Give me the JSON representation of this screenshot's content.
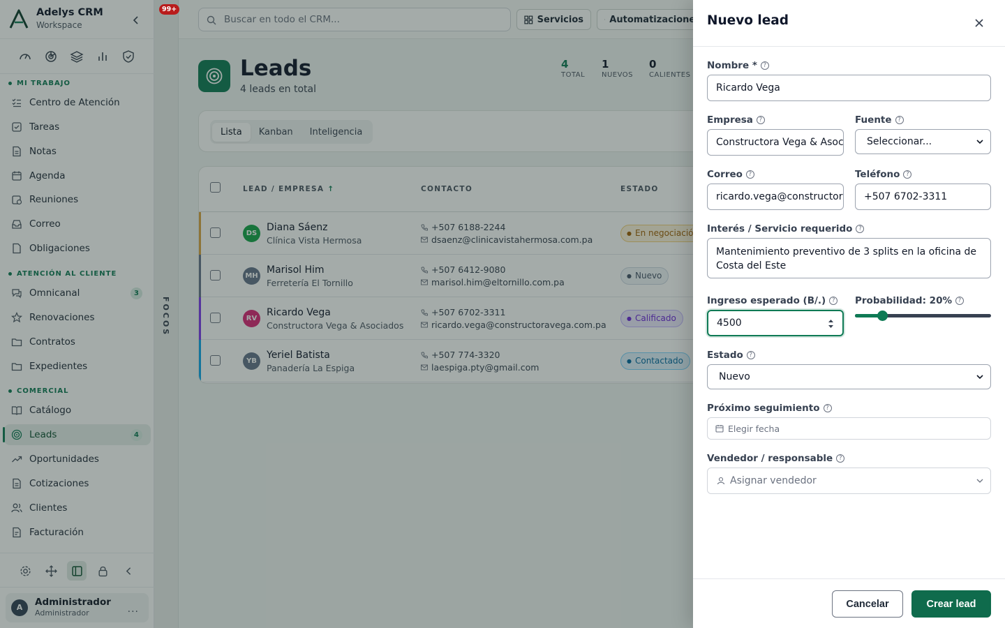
{
  "brand": {
    "title": "Adelys CRM",
    "subtitle": "Workspace"
  },
  "notification_badge": "99+",
  "sidebar": {
    "sections": {
      "mi_trabajo": "MI TRABAJO",
      "atencion": "ATENCIÓN AL CLIENTE",
      "comercial": "COMERCIAL"
    },
    "items": [
      {
        "label": "Centro de Atención"
      },
      {
        "label": "Tareas"
      },
      {
        "label": "Notas"
      },
      {
        "label": "Agenda"
      },
      {
        "label": "Reuniones"
      },
      {
        "label": "Correo"
      },
      {
        "label": "Obligaciones"
      },
      {
        "label": "Omnicanal",
        "badge": "3"
      },
      {
        "label": "Renovaciones"
      },
      {
        "label": "Contratos"
      },
      {
        "label": "Expedientes"
      },
      {
        "label": "Catálogo"
      },
      {
        "label": "Leads",
        "badge": "4"
      },
      {
        "label": "Oportunidades"
      },
      {
        "label": "Cotizaciones"
      },
      {
        "label": "Clientes"
      },
      {
        "label": "Facturación"
      }
    ]
  },
  "user": {
    "name": "Administrador",
    "role": "Administrador",
    "initial": "A",
    "more": "···"
  },
  "focus_label": "FOCOS",
  "topbar": {
    "search_placeholder": "Buscar en todo el CRM...",
    "btn_servicios": "Servicios",
    "btn_automatizaciones": "Automatizaciones"
  },
  "page": {
    "title": "Leads",
    "subtitle": "4 leads en total",
    "stats": [
      {
        "value": "4",
        "label": "TOTAL"
      },
      {
        "value": "1",
        "label": "NUEVOS"
      },
      {
        "value": "0",
        "label": "CALIENTES"
      }
    ]
  },
  "view_tabs": [
    "Lista",
    "Kanban",
    "Inteligencia"
  ],
  "table": {
    "columns": {
      "lead": "LEAD / EMPRESA",
      "sort": "↑",
      "contact": "CONTACTO",
      "status": "ESTADO"
    },
    "rows": [
      {
        "initials": "DS",
        "name": "Diana Sáenz",
        "company": "Clínica Vista Hermosa",
        "phone": "+507 6188-2244",
        "email": "dsaenz@clinicavistahermosa.com.pa",
        "status": "En negociación",
        "bar": "#d9a441",
        "avatar": "#16a34a",
        "st_bg": "#fdf3dc",
        "st_fg": "#a16207",
        "st_bd": "#f2cf7a"
      },
      {
        "initials": "MH",
        "name": "Marisol Him",
        "company": "Ferretería El Tornillo",
        "phone": "+507 6412-9080",
        "email": "marisol.him@eltornillo.com.pa",
        "status": "Nuevo",
        "bar": "#64748b",
        "avatar": "#64748b",
        "st_bg": "#f1f5f9",
        "st_fg": "#475569",
        "st_bd": "#cbd5e1"
      },
      {
        "initials": "RV",
        "name": "Ricardo Vega",
        "company": "Constructora Vega & Asociados",
        "phone": "+507 6702-3311",
        "email": "ricardo.vega@constructoravega.com.pa",
        "status": "Calificado",
        "bar": "#7c3aed",
        "avatar": "#db2777",
        "st_bg": "#ede9fe",
        "st_fg": "#6d28d9",
        "st_bd": "#c4b5fd"
      },
      {
        "initials": "YB",
        "name": "Yeriel Batista",
        "company": "Panadería La Espiga",
        "phone": "+507 774-3320",
        "email": "laespiga.pty@gmail.com",
        "status": "Contactado",
        "bar": "#0ea5e9",
        "avatar": "#64748b",
        "st_bg": "#e0f2fe",
        "st_fg": "#0369a1",
        "st_bd": "#7dd3fc"
      }
    ]
  },
  "drawer": {
    "title": "Nuevo lead",
    "nombre_label": "Nombre *",
    "nombre_value": "Ricardo Vega",
    "empresa_label": "Empresa",
    "empresa_value": "Constructora Vega & Asociados",
    "fuente_label": "Fuente",
    "fuente_value": "Seleccionar...",
    "correo_label": "Correo",
    "correo_value": "ricardo.vega@constructoravega.com.pa",
    "telefono_label": "Teléfono",
    "telefono_value": "+507 6702-3311",
    "interes_label": "Interés / Servicio requerido",
    "interes_value": "Mantenimiento preventivo de 3 splits en la oficina de Costa del Este",
    "ingreso_label": "Ingreso esperado (B/.)",
    "ingreso_value": "4500",
    "probabilidad_label": "Probabilidad: 20%",
    "probabilidad": 0.2,
    "estado_label": "Estado",
    "estado_value": "Nuevo",
    "seguimiento_label": "Próximo seguimiento",
    "seguimiento_placeholder": "Elegir fecha",
    "vendedor_label": "Vendedor / responsable",
    "vendedor_placeholder": "Asignar vendedor",
    "cancel": "Cancelar",
    "create": "Crear lead",
    "help": "?"
  },
  "colors": {
    "accent": "#0f7a55",
    "primary_button": "#0f6b4c",
    "danger": "#b91c1c"
  }
}
